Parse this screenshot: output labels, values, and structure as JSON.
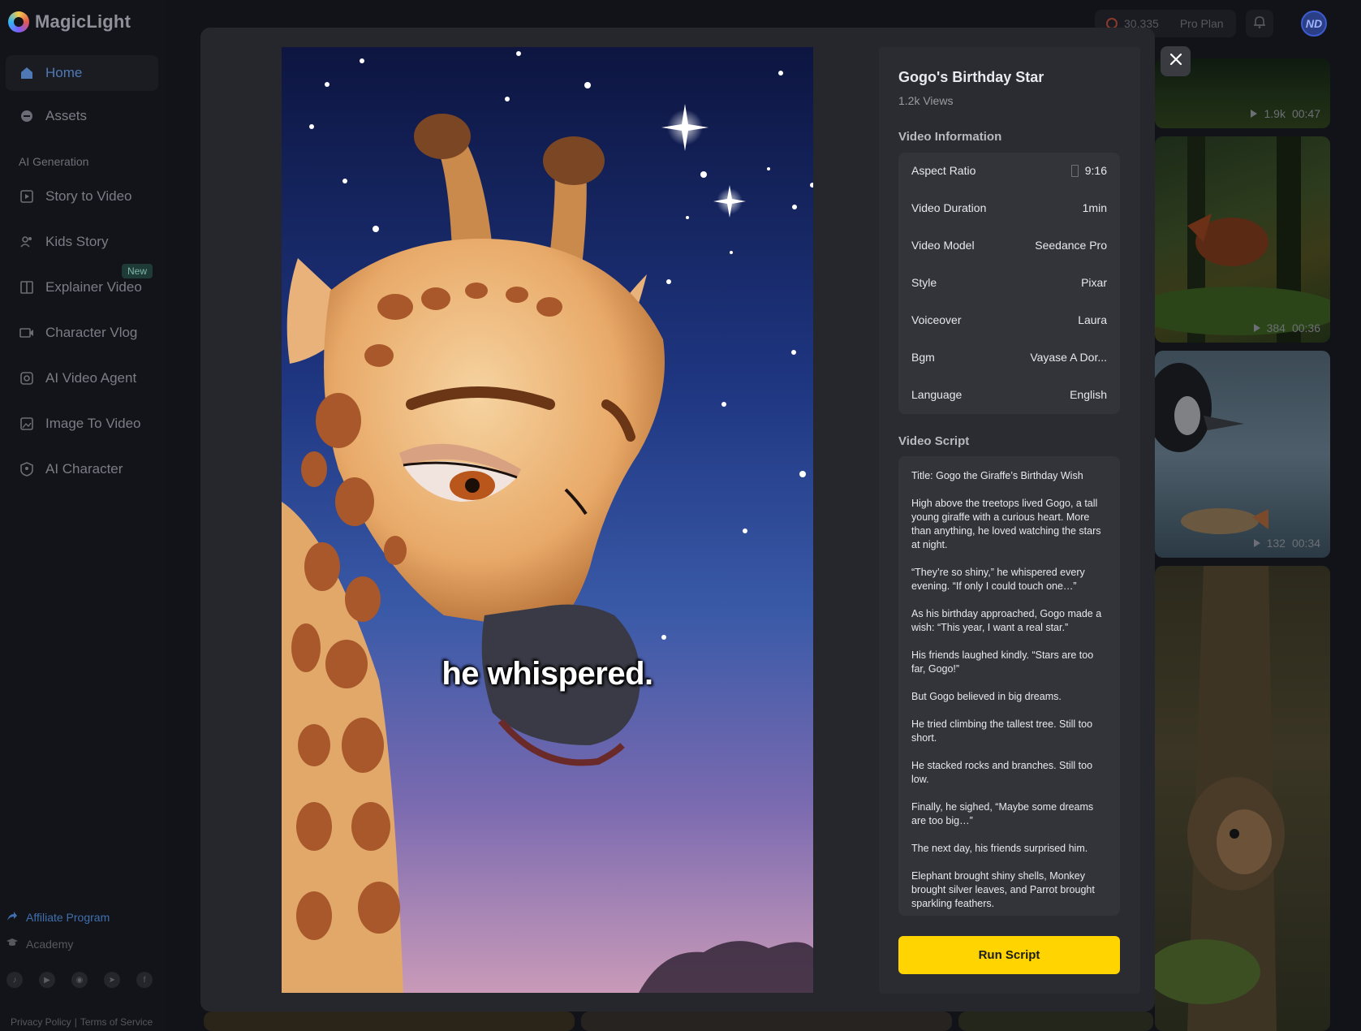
{
  "app": {
    "name": "MagicLight"
  },
  "topbar": {
    "credits": "30,335",
    "plan": "Pro Plan",
    "avatar_initials": "ND"
  },
  "sidebar": {
    "items": [
      {
        "label": "Home",
        "icon": "home-icon"
      },
      {
        "label": "Assets",
        "icon": "assets-icon"
      }
    ],
    "section_label": "AI Generation",
    "gen_items": [
      {
        "label": "Story to Video",
        "icon": "play-square-icon"
      },
      {
        "label": "Kids Story",
        "icon": "kids-icon"
      },
      {
        "label": "Explainer Video",
        "icon": "book-icon",
        "badge": "New"
      },
      {
        "label": "Character Vlog",
        "icon": "camera-icon"
      },
      {
        "label": "AI Video Agent",
        "icon": "agent-icon"
      },
      {
        "label": "Image To Video",
        "icon": "image-icon"
      },
      {
        "label": "AI Character",
        "icon": "character-icon"
      }
    ],
    "affiliate": "Affiliate Program",
    "academy": "Academy",
    "socials": [
      "tiktok-icon",
      "youtube-icon",
      "discord-icon",
      "telegram-icon",
      "facebook-icon"
    ],
    "privacy": "Privacy Policy",
    "separator": "|",
    "terms": "Terms of Service"
  },
  "gallery": [
    {
      "views": "1.9k",
      "duration": "00:47"
    },
    {
      "views": "384",
      "duration": "00:36"
    },
    {
      "views": "132",
      "duration": "00:34"
    }
  ],
  "modal": {
    "subtitle": "he whispered.",
    "title": "Gogo's Birthday Star",
    "views": "1.2k Views",
    "info_heading": "Video Information",
    "info": [
      {
        "label": "Aspect Ratio",
        "value": "9:16"
      },
      {
        "label": "Video Duration",
        "value": "1min"
      },
      {
        "label": "Video Model",
        "value": "Seedance Pro"
      },
      {
        "label": "Style",
        "value": "Pixar"
      },
      {
        "label": "Voiceover",
        "value": "Laura"
      },
      {
        "label": "Bgm",
        "value": "Vayase A Dor..."
      },
      {
        "label": "Language",
        "value": "English"
      }
    ],
    "script_heading": "Video Script",
    "script": [
      "Title: Gogo the Giraffe’s Birthday Wish",
      "High above the treetops lived Gogo, a tall young giraffe with a curious heart. More than anything, he loved watching the stars at night.",
      "“They’re so shiny,” he whispered every evening. “If only I could touch one…”",
      "As his birthday approached, Gogo made a wish: “This year, I want a real star.”",
      "His friends laughed kindly. “Stars are too far, Gogo!”",
      "But Gogo believed in big dreams.",
      "He tried climbing the tallest tree. Still too short.",
      "He stacked rocks and branches. Still too low.",
      "Finally, he sighed, “Maybe some dreams are too big…”",
      "The next day, his friends surprised him.",
      "Elephant brought shiny shells, Monkey brought silver leaves, and Parrot brought sparkling feathers."
    ],
    "run_button": "Run Script"
  }
}
